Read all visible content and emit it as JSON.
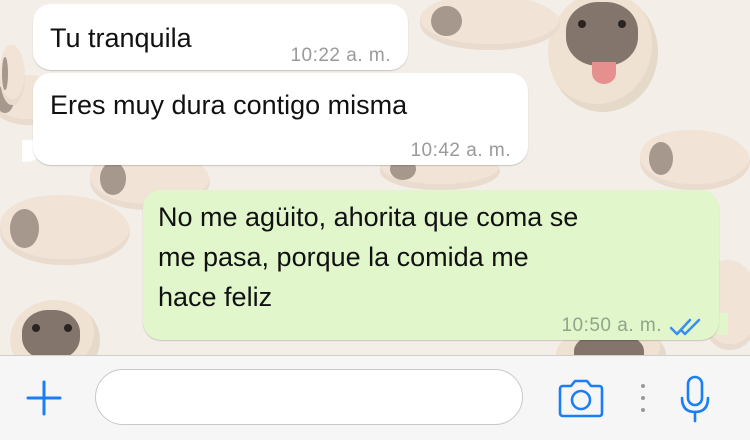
{
  "messages": [
    {
      "direction": "incoming",
      "text": "Tu tranquila",
      "time": "10:22 a. m."
    },
    {
      "direction": "incoming",
      "text": "Eres muy dura contigo misma",
      "time": "10:42 a. m."
    },
    {
      "direction": "outgoing",
      "text": "No me agüito, ahorita que coma se\nme pasa, porque la comida me\nhace feliz",
      "time": "10:50 a. m.",
      "status": "read"
    }
  ],
  "input_bar": {
    "message_value": "",
    "plus_icon": "plus-icon",
    "camera_icon": "camera-icon",
    "mic_icon": "microphone-icon"
  },
  "colors": {
    "accent": "#1a7ef7",
    "outgoing_bubble": "#e1f7cb",
    "incoming_bubble": "#ffffff",
    "read_ticks": "#3b8ef0"
  }
}
